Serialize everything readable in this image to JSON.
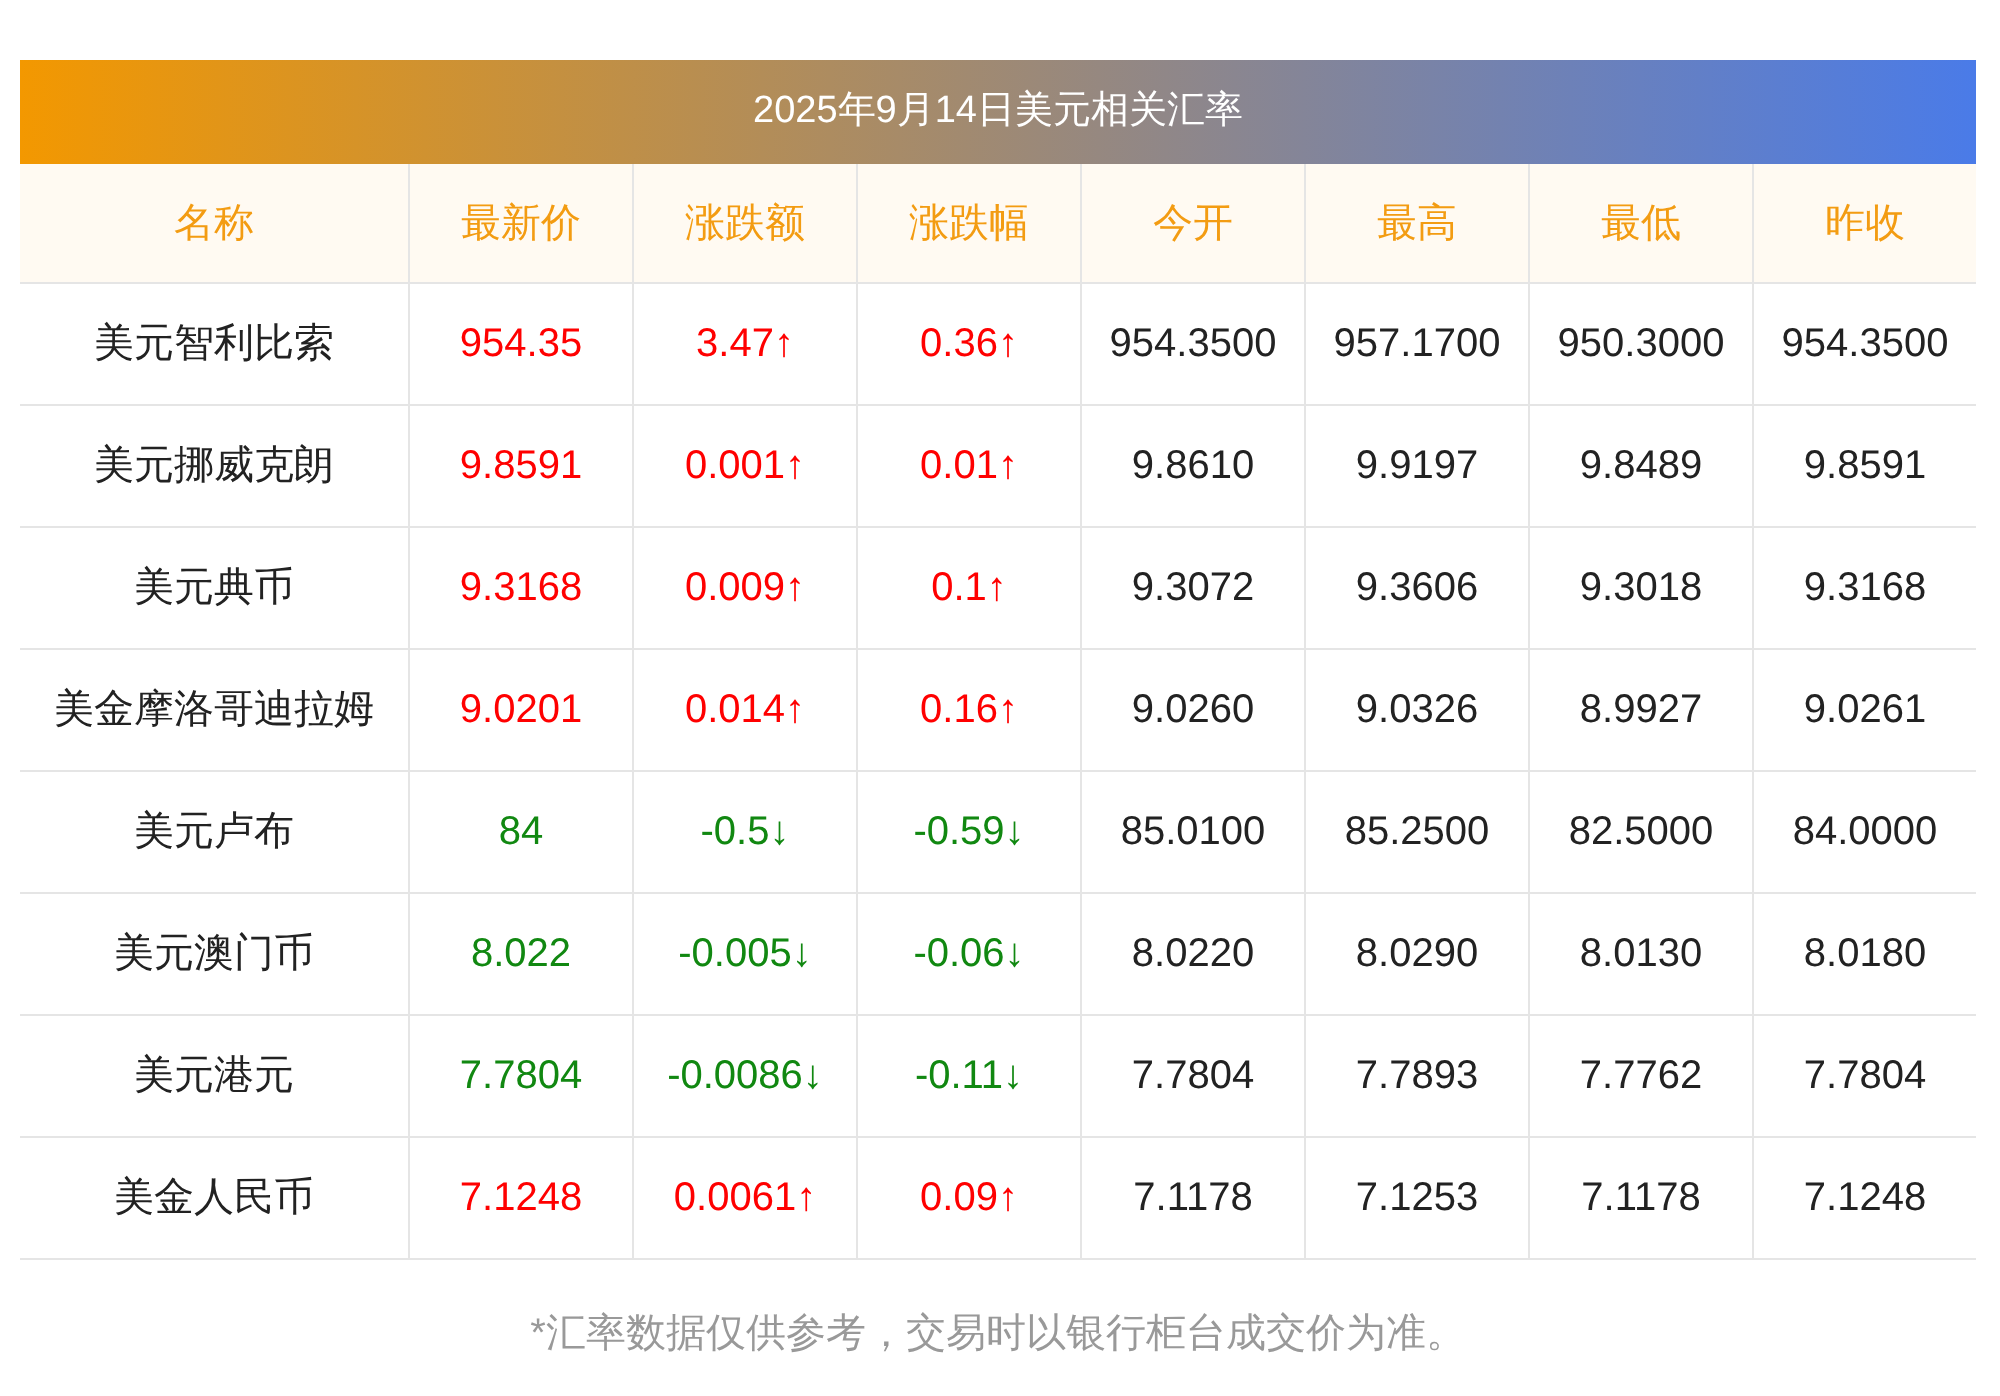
{
  "title": "2025年9月14日美元相关汇率",
  "columns": [
    "名称",
    "最新价",
    "涨跌额",
    "涨跌幅",
    "今开",
    "最高",
    "最低",
    "昨收"
  ],
  "rows": [
    {
      "kind": "up",
      "cells": [
        "美元智利比索",
        "954.35",
        "3.47↑",
        "0.36↑",
        "954.3500",
        "957.1700",
        "950.3000",
        "954.3500"
      ]
    },
    {
      "kind": "up",
      "cells": [
        "美元挪威克朗",
        "9.8591",
        "0.001↑",
        "0.01↑",
        "9.8610",
        "9.9197",
        "9.8489",
        "9.8591"
      ]
    },
    {
      "kind": "up",
      "cells": [
        "美元典币",
        "9.3168",
        "0.009↑",
        "0.1↑",
        "9.3072",
        "9.3606",
        "9.3018",
        "9.3168"
      ]
    },
    {
      "kind": "up",
      "cells": [
        "美金摩洛哥迪拉姆",
        "9.0201",
        "0.014↑",
        "0.16↑",
        "9.0260",
        "9.0326",
        "8.9927",
        "9.0261"
      ]
    },
    {
      "kind": "down",
      "cells": [
        "美元卢布",
        "84",
        "-0.5↓",
        "-0.59↓",
        "85.0100",
        "85.2500",
        "82.5000",
        "84.0000"
      ]
    },
    {
      "kind": "down",
      "cells": [
        "美元澳门币",
        "8.022",
        "-0.005↓",
        "-0.06↓",
        "8.0220",
        "8.0290",
        "8.0130",
        "8.0180"
      ]
    },
    {
      "kind": "down",
      "cells": [
        "美元港元",
        "7.7804",
        "-0.0086↓",
        "-0.11↓",
        "7.7804",
        "7.7893",
        "7.7762",
        "7.7804"
      ]
    },
    {
      "kind": "up",
      "cells": [
        "美金人民币",
        "7.1248",
        "0.0061↑",
        "0.09↑",
        "7.1178",
        "7.1253",
        "7.1178",
        "7.1248"
      ]
    }
  ],
  "footnote": "*汇率数据仅供参考，交易时以银行柜台成交价为准。"
}
